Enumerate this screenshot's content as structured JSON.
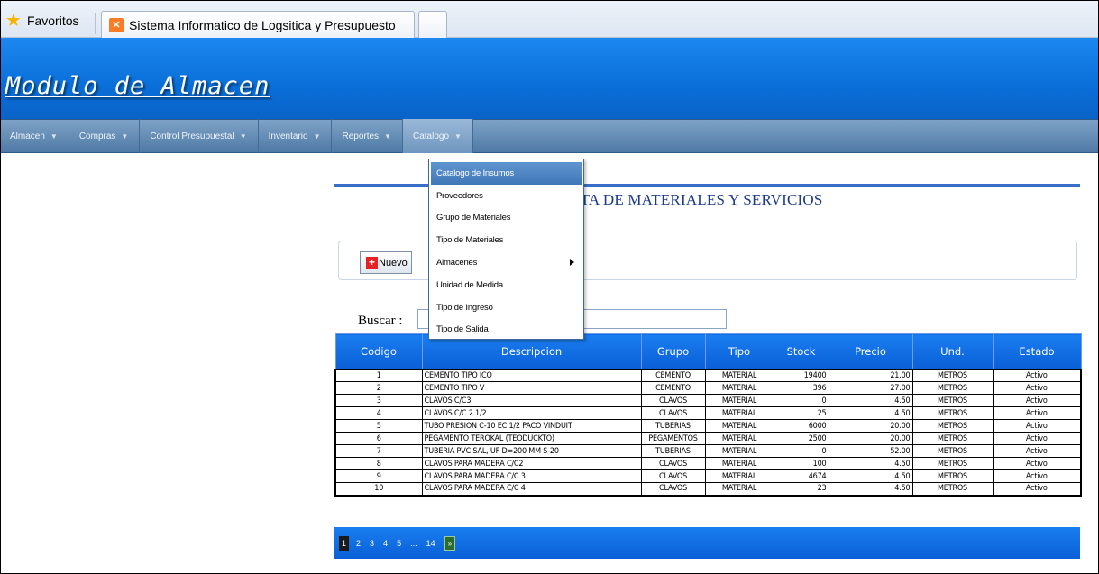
{
  "browser": {
    "favorites_label": "Favoritos",
    "tab_title": "Sistema Informatico de Logsitica y Presupuesto"
  },
  "header": {
    "title": "Modulo de Almacen"
  },
  "nav": {
    "items": [
      {
        "label": "Almacen"
      },
      {
        "label": "Compras"
      },
      {
        "label": "Control Presupuestal"
      },
      {
        "label": "Inventario"
      },
      {
        "label": "Reportes"
      },
      {
        "label": "Catalogo"
      }
    ]
  },
  "dropdown": {
    "items": [
      {
        "label": "Catalogo de Insumos",
        "highlighted": true
      },
      {
        "label": "Proveedores"
      },
      {
        "label": "Grupo de Materiales"
      },
      {
        "label": "Tipo de Materiales"
      },
      {
        "label": "Almacenes",
        "has_submenu": true
      },
      {
        "label": "Unidad de Medida"
      },
      {
        "label": "Tipo de Ingreso"
      },
      {
        "label": "Tipo de Salida"
      }
    ]
  },
  "page": {
    "heading": "NSULTA DE MATERIALES Y SERVICIOS",
    "new_button": "Nuevo",
    "search_label": "Buscar :",
    "search_value": ""
  },
  "table": {
    "headers": [
      "Codigo",
      "Descripcion",
      "Grupo",
      "Tipo",
      "Stock",
      "Precio",
      "Und.",
      "Estado"
    ],
    "rows": [
      [
        "1",
        "CEMENTO TIPO ICO",
        "CEMENTO",
        "MATERIAL",
        "19400",
        "21.00",
        "METROS",
        "Activo"
      ],
      [
        "2",
        "CEMENTO TIPO V",
        "CEMENTO",
        "MATERIAL",
        "396",
        "27.00",
        "METROS",
        "Activo"
      ],
      [
        "3",
        "CLAVOS C/C3",
        "CLAVOS",
        "MATERIAL",
        "0",
        "4.50",
        "METROS",
        "Activo"
      ],
      [
        "4",
        "CLAVOS C/C 2 1/2",
        "CLAVOS",
        "MATERIAL",
        "25",
        "4.50",
        "METROS",
        "Activo"
      ],
      [
        "5",
        "TUBO PRESION C-10 EC 1/2 PACO VINDUIT",
        "TUBERIAS",
        "MATERIAL",
        "6000",
        "20.00",
        "METROS",
        "Activo"
      ],
      [
        "6",
        "PEGAMENTO TEROKAL (TEODUCKTO)",
        "PEGAMENTOS",
        "MATERIAL",
        "2500",
        "20.00",
        "METROS",
        "Activo"
      ],
      [
        "7",
        "TUBERIA PVC SAL, UF D=200 MM S-20",
        "TUBERIAS",
        "MATERIAL",
        "0",
        "52.00",
        "METROS",
        "Activo"
      ],
      [
        "8",
        "CLAVOS PARA MADERA C/C2",
        "CLAVOS",
        "MATERIAL",
        "100",
        "4.50",
        "METROS",
        "Activo"
      ],
      [
        "9",
        "CLAVOS PARA MADERA C/C 3",
        "CLAVOS",
        "MATERIAL",
        "4674",
        "4.50",
        "METROS",
        "Activo"
      ],
      [
        "10",
        "CLAVOS PARA MADERA C/C 4",
        "CLAVOS",
        "MATERIAL",
        "23",
        "4.50",
        "METROS",
        "Activo"
      ]
    ]
  },
  "pager": {
    "pages": [
      "1",
      "2",
      "3",
      "4",
      "5",
      "...",
      "14"
    ],
    "current": "1",
    "next_label": "»"
  }
}
